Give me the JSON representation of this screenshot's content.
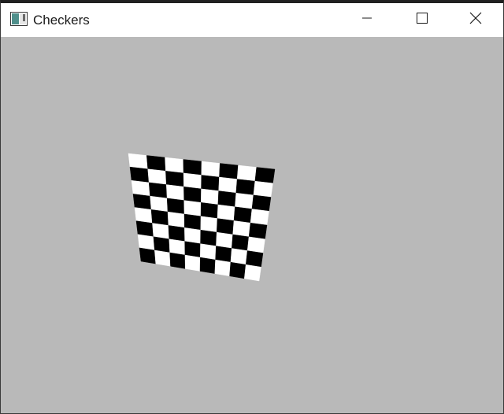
{
  "window": {
    "title": "Checkers",
    "background_color": "#b9b9b9",
    "icons": {
      "app": "app-window-icon",
      "minimize": "minimize-icon",
      "maximize": "maximize-icon",
      "close": "close-icon"
    }
  },
  "board": {
    "rows": 8,
    "cols": 8,
    "light_color": "#ffffff",
    "dark_color": "#000000"
  }
}
